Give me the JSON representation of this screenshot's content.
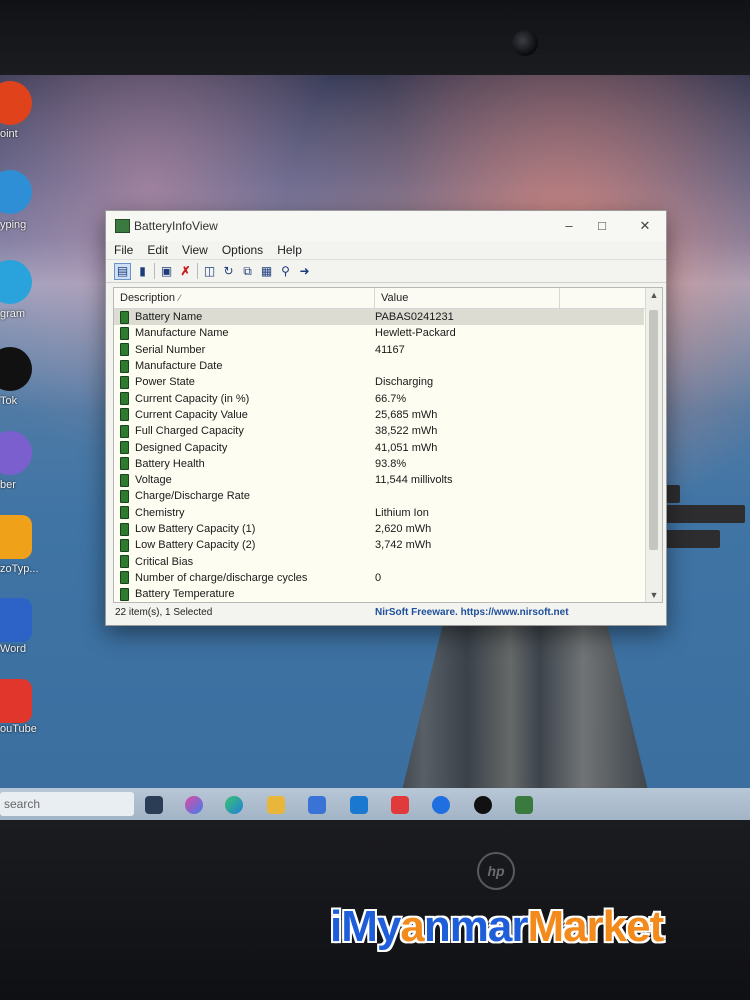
{
  "window": {
    "title": "BatteryInfoView",
    "menu": [
      "File",
      "Edit",
      "View",
      "Options",
      "Help"
    ],
    "columns": {
      "description": "Description",
      "value": "Value"
    },
    "rows": [
      {
        "label": "Battery Name",
        "value": "PABAS0241231",
        "selected": true
      },
      {
        "label": "Manufacture Name",
        "value": "Hewlett-Packard"
      },
      {
        "label": "Serial Number",
        "value": "41167"
      },
      {
        "label": "Manufacture Date",
        "value": ""
      },
      {
        "label": "Power State",
        "value": "Discharging"
      },
      {
        "label": "Current Capacity (in %)",
        "value": "66.7%"
      },
      {
        "label": "Current Capacity Value",
        "value": "25,685 mWh"
      },
      {
        "label": "Full Charged Capacity",
        "value": "38,522 mWh"
      },
      {
        "label": "Designed Capacity",
        "value": "41,051 mWh"
      },
      {
        "label": "Battery Health",
        "value": "93.8%"
      },
      {
        "label": "Voltage",
        "value": "11,544 millivolts"
      },
      {
        "label": "Charge/Discharge Rate",
        "value": ""
      },
      {
        "label": "Chemistry",
        "value": "Lithium Ion"
      },
      {
        "label": "Low Battery Capacity (1)",
        "value": "2,620 mWh"
      },
      {
        "label": "Low Battery Capacity (2)",
        "value": "3,742 mWh"
      },
      {
        "label": "Critical Bias",
        "value": ""
      },
      {
        "label": "Number of charge/discharge cycles",
        "value": "0"
      },
      {
        "label": "Battery Temperature",
        "value": ""
      }
    ],
    "status": {
      "items": "22 item(s), 1 Selected",
      "credit": "NirSoft Freeware. https://www.nirsoft.net"
    }
  },
  "desktop": {
    "icons": [
      "oint",
      "yping",
      "gram",
      "Tok",
      "ber",
      "zoTyp...",
      "Word",
      "ouTube"
    ]
  },
  "taskbar": {
    "search_placeholder": "search"
  },
  "watermark": {
    "part1": "iMy",
    "part2": "a",
    "part3": "nmar",
    "part4": "Market"
  },
  "laptop": {
    "logo": "hp"
  }
}
